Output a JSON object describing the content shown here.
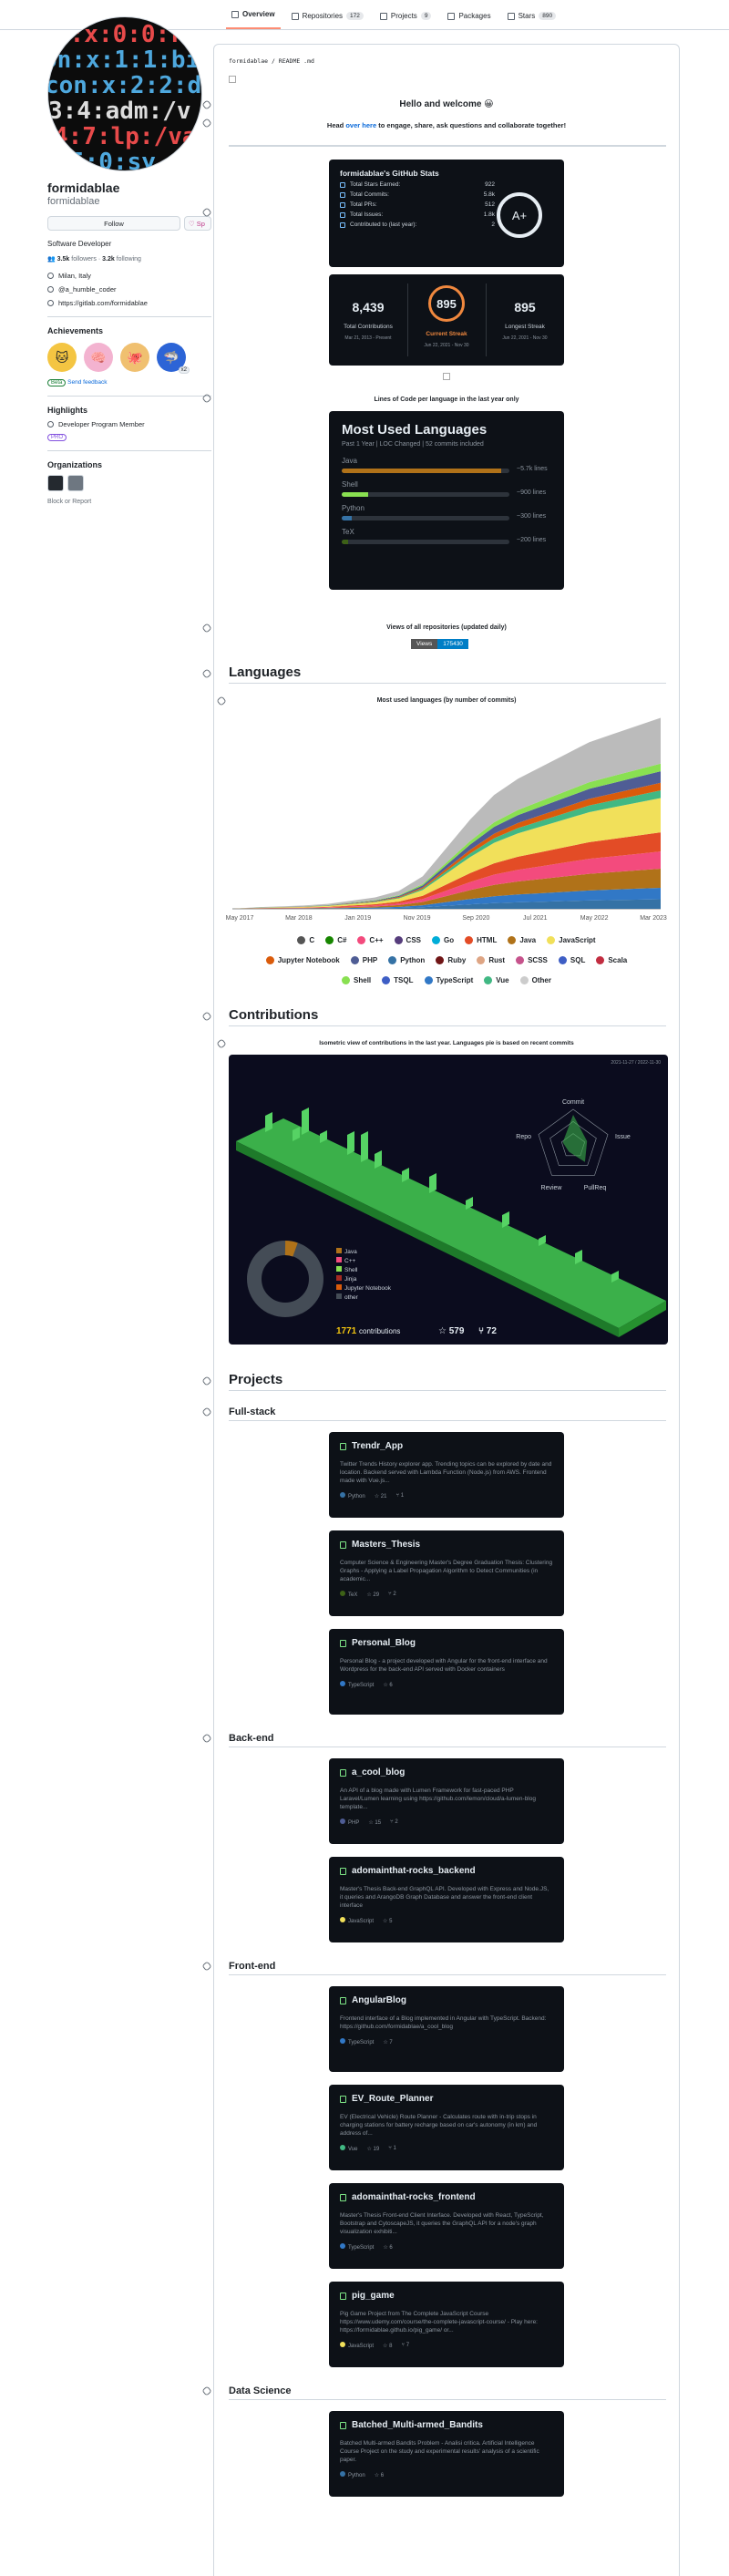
{
  "tabs": [
    {
      "label": "Overview",
      "count": ""
    },
    {
      "label": "Repositories",
      "count": "172"
    },
    {
      "label": "Projects",
      "count": "9"
    },
    {
      "label": "Packages",
      "count": ""
    },
    {
      "label": "Stars",
      "count": "890"
    }
  ],
  "profile": {
    "name": "formidablae",
    "login": "formidablae",
    "follow_label": "Follow",
    "sponsor_label": "Sp",
    "bio": "Software Developer",
    "followers": "3.5k",
    "followers_label": "followers",
    "following": "3.2k",
    "following_label": "following",
    "location": "Milan, Italy",
    "twitter": "@a_humble_coder",
    "website": "https://gitlab.com/formidablae",
    "achievements_title": "Achievements",
    "achievement_x2": "x2",
    "beta": "Beta",
    "feedback": "Send feedback",
    "highlights_title": "Highlights",
    "highlight_1": "Developer Program Member",
    "pro": "PRO",
    "orgs_title": "Organizations",
    "block": "Block or Report"
  },
  "readme": {
    "path": "formidablae / README .md",
    "hello": "Hello and welcome 😀",
    "head_prefix": "Head ",
    "head_link": "over here",
    "head_suffix": " to engage, share, ask questions and collaborate together!",
    "stats": {
      "title": "formidablae's GitHub Stats",
      "rows": [
        [
          "Total Stars Earned:",
          "922"
        ],
        [
          "Total Commits:",
          "5.8k"
        ],
        [
          "Total PRs:",
          "512"
        ],
        [
          "Total Issues:",
          "1.8k"
        ],
        [
          "Contributed to (last year):",
          "2"
        ]
      ],
      "grade": "A+"
    },
    "streak": {
      "total": "8,439",
      "total_label": "Total Contributions",
      "total_range": "Mar 21, 2013 - Present",
      "current": "895",
      "current_label": "Current Streak",
      "current_range": "Jun 22, 2021 - Nov 30",
      "longest": "895",
      "longest_label": "Longest Streak",
      "longest_range": "Jun 22, 2021 - Nov 30"
    },
    "loc_title": "Lines of Code per language in the last year only",
    "most_used": {
      "title": "Most Used Languages",
      "subtitle": "Past 1 Year | LOC Changed | 52 commits included",
      "langs": [
        {
          "name": "Java",
          "lines": "~5.7k lines",
          "pct": 0.95,
          "color": "#b07219"
        },
        {
          "name": "Shell",
          "lines": "~900 lines",
          "pct": 0.16,
          "color": "#89e051"
        },
        {
          "name": "Python",
          "lines": "~300 lines",
          "pct": 0.06,
          "color": "#3572A5"
        },
        {
          "name": "TeX",
          "lines": "~200 lines",
          "pct": 0.04,
          "color": "#3D6117"
        }
      ]
    },
    "views_title": "Views of all repositories (updated daily)",
    "views_label": "Views",
    "views_value": "175430",
    "languages_h": "Languages",
    "lang_chart_title": "Most used languages (by number of commits)",
    "contrib_h": "Contributions",
    "contrib_title": "Isometric view of contributions in the last year. Languages pie is based on recent commits",
    "contrib_card": {
      "range": "2021-11-27 / 2022-11-30",
      "radar": [
        "Commit",
        "Issue",
        "PullReq",
        "Review",
        "Repo"
      ],
      "pie": [
        {
          "name": "Java",
          "color": "#b07219"
        },
        {
          "name": "C++",
          "color": "#f34b7d"
        },
        {
          "name": "Shell",
          "color": "#89e051"
        },
        {
          "name": "Jinja",
          "color": "#a52a22"
        },
        {
          "name": "Jupyter Notebook",
          "color": "#DA5B0B"
        },
        {
          "name": "other",
          "color": "#444c56"
        }
      ],
      "contribs": "1771",
      "contribs_label": "contributions",
      "stars": "579",
      "forks": "72"
    },
    "projects_h": "Projects",
    "groups": [
      {
        "title": "Full-stack",
        "projects": [
          {
            "name": "Trendr_App",
            "desc": "Twitter Trends History explorer app. Trending topics can be explored by date and location. Backend served with Lambda Function (Node.js) from AWS. Frontend made with Vue.js...",
            "lang": "Python",
            "lang_color": "#3572A5",
            "stars": "21",
            "forks": "1"
          },
          {
            "name": "Masters_Thesis",
            "desc": "Computer Science & Engineering Master's Degree Graduation Thesis: Clustering Graphs - Applying a Label Propagation Algorithm to Detect Communities (in academic...",
            "lang": "TeX",
            "lang_color": "#3D6117",
            "stars": "29",
            "forks": "2"
          },
          {
            "name": "Personal_Blog",
            "desc": "Personal Blog - a project developed with Angular for the front-end interface and Wordpress for the back-end API served with Docker containers",
            "lang": "TypeScript",
            "lang_color": "#3178c6",
            "stars": "6",
            "forks": ""
          }
        ]
      },
      {
        "title": "Back-end",
        "projects": [
          {
            "name": "a_cool_blog",
            "desc": "An API of a blog made with Lumen Framework for fast-paced PHP Laravel/Lumen learning using https://github.com/lemon/cloud/a-lumen-blog template...",
            "lang": "PHP",
            "lang_color": "#4F5D95",
            "stars": "15",
            "forks": "2"
          },
          {
            "name": "adomainthat-rocks_backend",
            "desc": "Master's Thesis Back-end GraphQL API. Developed with Express and Node.JS, it queries and ArangoDB Graph Database and answer the front-end client interface",
            "lang": "JavaScript",
            "lang_color": "#f1e05a",
            "stars": "5",
            "forks": ""
          }
        ]
      },
      {
        "title": "Front-end",
        "projects": [
          {
            "name": "AngularBlog",
            "desc": "Frontend interface of a Blog implemented in Angular with TypeScript. Backend: https://github.com/formidablae/a_cool_blog",
            "lang": "TypeScript",
            "lang_color": "#3178c6",
            "stars": "7",
            "forks": ""
          },
          {
            "name": "EV_Route_Planner",
            "desc": "EV (Electrical Vehicle) Route Planner - Calculates route with in-trip stops in charging stations for battery recharge based on car's autonomy (in km) and address of...",
            "lang": "Vue",
            "lang_color": "#41b883",
            "stars": "19",
            "forks": "1"
          },
          {
            "name": "adomainthat-rocks_frontend",
            "desc": "Master's Thesis Front-end Client Interface. Developed with React, TypeScript, Bootstrap and CytoscapeJS, it queries the GraphQL API for a node's graph visualization exhibiti...",
            "lang": "TypeScript",
            "lang_color": "#3178c6",
            "stars": "6",
            "forks": ""
          },
          {
            "name": "pig_game",
            "desc": "Pig Game Project from The Complete JavaScript Course https://www.udemy.com/course/the-complete-javascript-course/ - Play here: https://formidablae.github.io/pig_game/ or...",
            "lang": "JavaScript",
            "lang_color": "#f1e05a",
            "stars": "8",
            "forks": "7"
          }
        ]
      },
      {
        "title": "Data Science",
        "projects": [
          {
            "name": "Batched_Multi-armed_Bandits",
            "desc": "Batched Multi-armed Bandits Problem - Analisi critica. Artificial Intelligence Course Project on the study and experimental results' analysis of a scientific paper.",
            "lang": "Python",
            "lang_color": "#3572A5",
            "stars": "6",
            "forks": ""
          }
        ]
      }
    ]
  },
  "chart_data": {
    "type": "area",
    "title": "Most used languages (by number of commits)",
    "xlabel": "",
    "ylabel": "",
    "x": [
      "May 2017",
      "Mar 2018",
      "Jan 2019",
      "Nov 2019",
      "Sep 2020",
      "Jul 2021",
      "May 2022",
      "Mar 2023"
    ],
    "series": [
      {
        "name": "C",
        "color": "#555555"
      },
      {
        "name": "C#",
        "color": "#178600"
      },
      {
        "name": "C++",
        "color": "#f34b7d"
      },
      {
        "name": "CSS",
        "color": "#563d7c"
      },
      {
        "name": "Go",
        "color": "#00ADD8"
      },
      {
        "name": "HTML",
        "color": "#e34c26"
      },
      {
        "name": "Java",
        "color": "#b07219"
      },
      {
        "name": "JavaScript",
        "color": "#f1e05a"
      },
      {
        "name": "Jupyter Notebook",
        "color": "#DA5B0B"
      },
      {
        "name": "PHP",
        "color": "#4F5D95"
      },
      {
        "name": "Python",
        "color": "#3572A5"
      },
      {
        "name": "Ruby",
        "color": "#701516"
      },
      {
        "name": "Rust",
        "color": "#dea584"
      },
      {
        "name": "SCSS",
        "color": "#c6538c"
      },
      {
        "name": "SQL",
        "color": "#3e5ec5"
      },
      {
        "name": "Scala",
        "color": "#c22d40"
      },
      {
        "name": "Shell",
        "color": "#89e051"
      },
      {
        "name": "TSQL",
        "color": "#3e5ec5"
      },
      {
        "name": "TypeScript",
        "color": "#3178c6"
      },
      {
        "name": "Vue",
        "color": "#41b883"
      },
      {
        "name": "Other",
        "color": "#cccccc"
      }
    ],
    "stack_totals": [
      0,
      2,
      3,
      4,
      6,
      10,
      14,
      22,
      40,
      75,
      110,
      140,
      160,
      175,
      190,
      205,
      215,
      225,
      235
    ],
    "bands": [
      {
        "name": "Python",
        "color": "#3572A5",
        "share": 0.05
      },
      {
        "name": "TypeScript",
        "color": "#3178c6",
        "share": 0.06
      },
      {
        "name": "Java",
        "color": "#b07219",
        "share": 0.1
      },
      {
        "name": "C++",
        "color": "#f34b7d",
        "share": 0.09
      },
      {
        "name": "HTML",
        "color": "#e34c26",
        "share": 0.1
      },
      {
        "name": "JavaScript",
        "color": "#f1e05a",
        "share": 0.18
      },
      {
        "name": "Vue",
        "color": "#41b883",
        "share": 0.04
      },
      {
        "name": "Jupyter Notebook",
        "color": "#DA5B0B",
        "share": 0.04
      },
      {
        "name": "PHP",
        "color": "#4F5D95",
        "share": 0.06
      },
      {
        "name": "Shell",
        "color": "#89e051",
        "share": 0.04
      },
      {
        "name": "Other",
        "color": "#bbbbbb",
        "share": 0.24
      }
    ]
  }
}
